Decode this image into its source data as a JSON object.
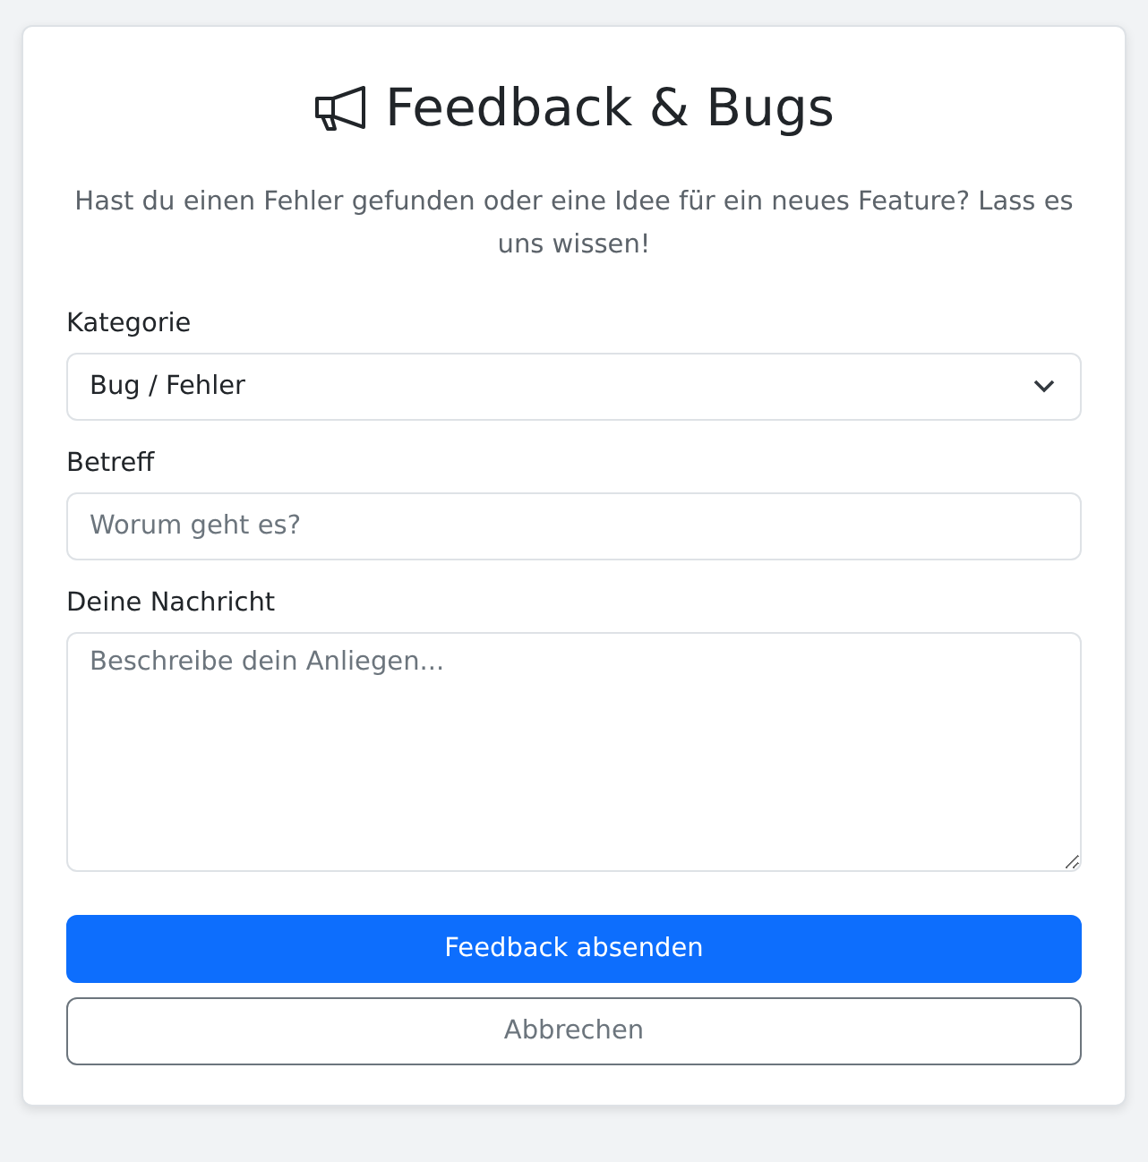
{
  "title": "Feedback & Bugs",
  "intro": "Hast du einen Fehler gefunden oder eine Idee für ein neues Feature? Lass es uns wissen!",
  "fields": [
    {
      "kind": "select",
      "label": "Kategorie",
      "value": "Bug / Fehler"
    },
    {
      "kind": "input",
      "label": "Betreff",
      "placeholder": "Worum geht es?"
    },
    {
      "kind": "textarea",
      "label": "Deine Nachricht",
      "placeholder": "Beschreibe dein Anliegen..."
    }
  ],
  "buttons": [
    {
      "label": "Feedback absenden",
      "kind": "primary"
    },
    {
      "label": "Abbrechen",
      "kind": "secondary"
    }
  ]
}
